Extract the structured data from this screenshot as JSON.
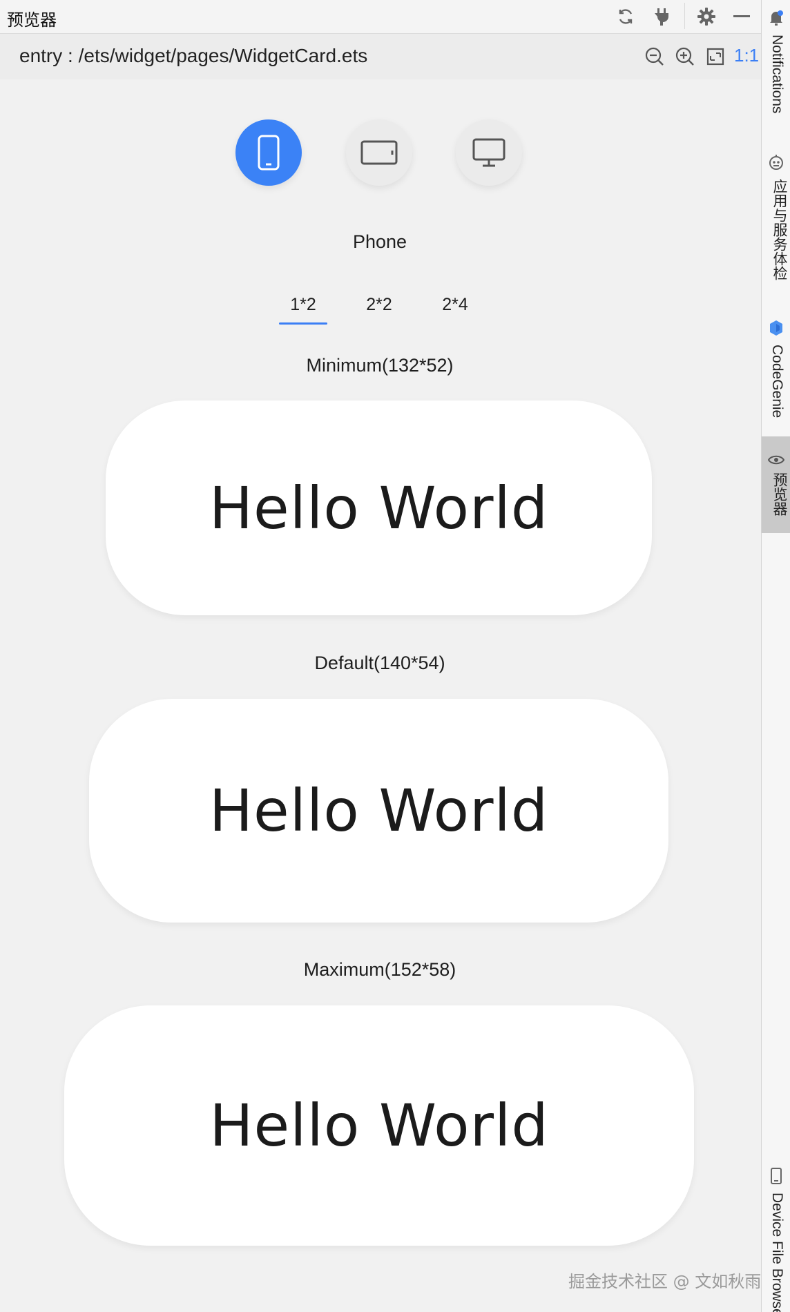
{
  "window": {
    "title": "预览器"
  },
  "path": {
    "text": "entry : /ets/widget/pages/WidgetCard.ets",
    "ratio": "1:1"
  },
  "devices": [
    {
      "name": "phone",
      "active": true
    },
    {
      "name": "tablet",
      "active": false
    },
    {
      "name": "desktop",
      "active": false
    }
  ],
  "device_label": "Phone",
  "tabs": [
    {
      "label": "1*2",
      "active": true
    },
    {
      "label": "2*2",
      "active": false
    },
    {
      "label": "2*4",
      "active": false
    }
  ],
  "cards": [
    {
      "label": "Minimum(132*52)",
      "text": "Hello World"
    },
    {
      "label": "Default(140*54)",
      "text": "Hello World"
    },
    {
      "label": "Maximum(152*58)",
      "text": "Hello World"
    }
  ],
  "sidebar": {
    "items": [
      {
        "label": "Notifications",
        "icon": "bell-icon"
      },
      {
        "label": "应用与服务体检",
        "icon": "robot-icon"
      },
      {
        "label": "CodeGenie",
        "icon": "codegenie-icon"
      },
      {
        "label": "预览器",
        "icon": "eye-icon"
      },
      {
        "label": "Device File Browser",
        "icon": "device-icon"
      }
    ]
  },
  "watermark": "掘金技术社区 @ 文如秋雨",
  "colors": {
    "accent": "#3b7ff5",
    "active_device": "#3b82f6",
    "background": "#f1f1f1",
    "card": "#ffffff"
  }
}
